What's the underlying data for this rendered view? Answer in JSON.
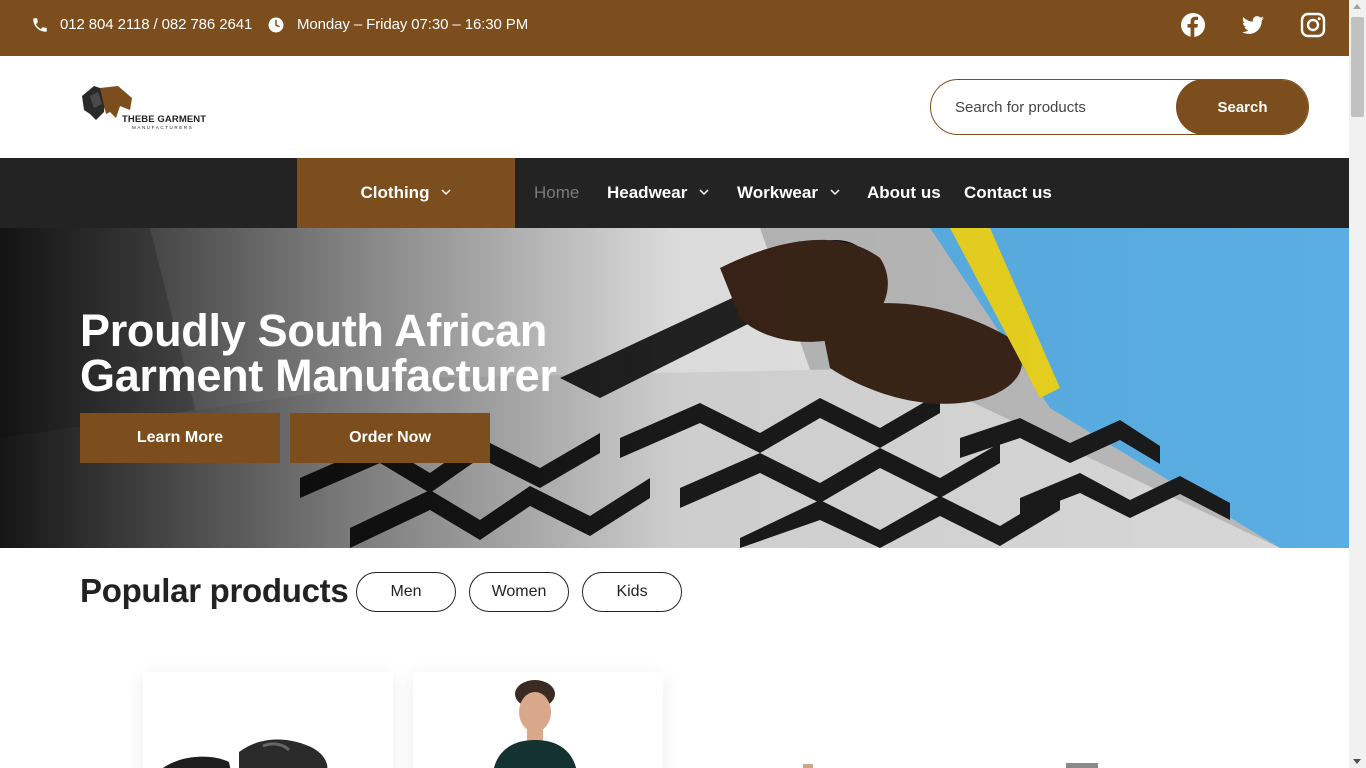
{
  "topbar": {
    "phone": "012 804 2118 / 082 786 2641",
    "hours": "Monday – Friday 07:30 – 16:30 PM",
    "social_icons": [
      "facebook-icon",
      "twitter-icon",
      "instagram-icon"
    ]
  },
  "header": {
    "logo": {
      "title": "THEBE GARMENT",
      "subtitle": "MANUFACTURERS"
    },
    "search": {
      "placeholder": "Search for products",
      "button_label": "Search"
    }
  },
  "nav": {
    "category_label": "Clothing",
    "items": [
      {
        "label": "Home",
        "active": true
      },
      {
        "label": "Headwear",
        "dropdown": true
      },
      {
        "label": "Workwear",
        "dropdown": true
      },
      {
        "label": "About us"
      },
      {
        "label": "Contact us"
      }
    ]
  },
  "hero": {
    "title": "Proudly South African Garment Manufacturer",
    "buttons": {
      "learn_more": "Learn More",
      "order_now": "Order Now"
    }
  },
  "popular": {
    "title": "Popular products",
    "filters": [
      "Men",
      "Women",
      "Kids"
    ]
  },
  "colors": {
    "brand_brown": "#7c4d1d",
    "nav_dark": "#232323",
    "white": "#ffffff"
  }
}
